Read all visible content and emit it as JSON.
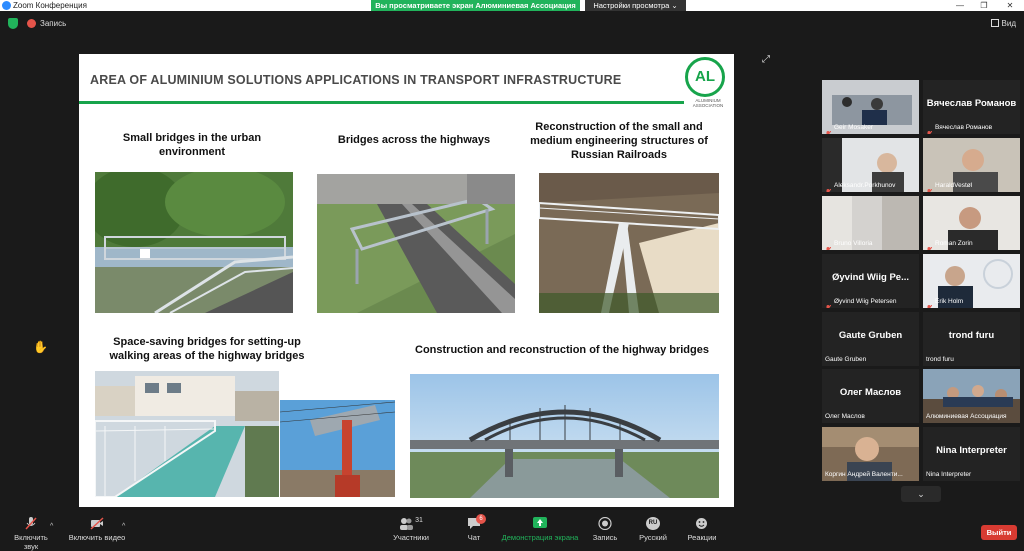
{
  "window": {
    "title": "Zoom Конференция",
    "minimize": "—",
    "maximize": "❐",
    "close": "✕"
  },
  "share_banner": "Вы просматриваете экран Алюминиевая Ассоциация",
  "view_options": "Настройки просмотра",
  "recording": {
    "label": "Запись"
  },
  "view_button": "Вид",
  "slide": {
    "title": "AREA OF ALUMINIUM SOLUTIONS APPLICATIONS IN TRANSPORT INFRASTRUCTURE",
    "logo_letters": "AL",
    "logo_caption": "ALUMINIUM ASSOCIATION",
    "captions": [
      "Small bridges in the urban environment",
      "Bridges across the highways",
      "Reconstruction of the small and medium engineering structures of Russian Railroads",
      "Space-saving bridges for setting-up walking areas of the highway bridges",
      "Construction and reconstruction of the highway bridges"
    ]
  },
  "participants": [
    {
      "name": "Geir Mosaker",
      "big": "",
      "muted": true
    },
    {
      "name": "Вячеслав Романов",
      "big": "Вячеслав Романов",
      "muted": true
    },
    {
      "name": "Aleksandr.Porkhunov",
      "big": "",
      "muted": true
    },
    {
      "name": "HaraldVestøl",
      "big": "",
      "muted": true
    },
    {
      "name": "Bruno Villoria",
      "big": "",
      "muted": true
    },
    {
      "name": "Roman Zorin",
      "big": "",
      "muted": true
    },
    {
      "name": "Øyvind Wiig Petersen",
      "big": "Øyvind Wiig Pe...",
      "muted": true
    },
    {
      "name": "Erik Holm",
      "big": "",
      "muted": true
    },
    {
      "name": "Gaute Gruben",
      "big": "Gaute Gruben",
      "muted": false
    },
    {
      "name": "trond furu",
      "big": "trond furu",
      "muted": false
    },
    {
      "name": "Олег Маслов",
      "big": "Олег Маслов",
      "muted": false
    },
    {
      "name": "Алюминиевая Ассоциация",
      "big": "",
      "muted": false
    },
    {
      "name": "Коргин Андрей Валенти...",
      "big": "",
      "muted": false
    },
    {
      "name": "Nina Interpreter",
      "big": "Nina Interpreter",
      "muted": false
    }
  ],
  "toolbar": {
    "unmute": "Включить звук",
    "start_video": "Включить видео",
    "participants": "Участники",
    "participants_count": "31",
    "chat": "Чат",
    "chat_badge": "6",
    "share_screen": "Демонстрация экрана",
    "record": "Запись",
    "interpretation": "Русский",
    "interpretation_code": "RU",
    "reactions": "Реакции",
    "leave": "Выйти"
  },
  "colors": {
    "share_green": "#21b35b",
    "brand_green": "#17a44b",
    "leave_red": "#d83b32",
    "active_speaker": "#d8e63a"
  }
}
